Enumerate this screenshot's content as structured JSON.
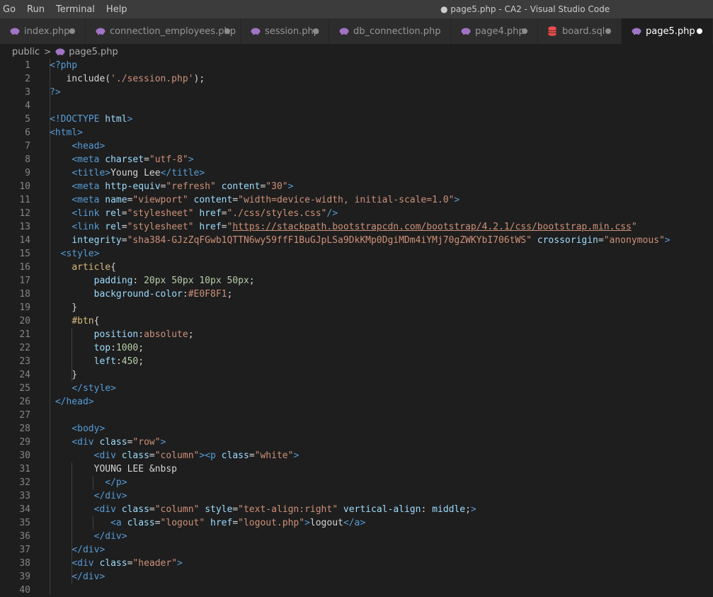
{
  "menu": [
    "Go",
    "Run",
    "Terminal",
    "Help"
  ],
  "window_title": "● page5.php - CA2 - Visual Studio Code",
  "tabs": [
    {
      "label": "index.php",
      "icon": "php-elephant-icon",
      "icon_color": "#a074c4",
      "modified": true,
      "active": false
    },
    {
      "label": "connection_employees.php",
      "icon": "php-elephant-icon",
      "icon_color": "#a074c4",
      "modified": true,
      "active": false
    },
    {
      "label": "session.php",
      "icon": "php-elephant-icon",
      "icon_color": "#a074c4",
      "modified": true,
      "active": false
    },
    {
      "label": "db_connection.php",
      "icon": "php-elephant-icon",
      "icon_color": "#a074c4",
      "modified": false,
      "active": false
    },
    {
      "label": "page4.php",
      "icon": "php-elephant-icon",
      "icon_color": "#a074c4",
      "modified": true,
      "active": false
    },
    {
      "label": "board.sql",
      "icon": "database-icon",
      "icon_color": "#f14c4c",
      "modified": true,
      "active": false
    },
    {
      "label": "page5.php",
      "icon": "php-elephant-icon",
      "icon_color": "#a074c4",
      "modified": true,
      "active": true
    }
  ],
  "breadcrumb": {
    "folder": "public",
    "file": "page5.php"
  },
  "code_lines": [
    [
      [
        "php",
        "<?php"
      ]
    ],
    [
      [
        "text",
        "   include("
      ],
      [
        "str",
        "'./session.php'"
      ],
      [
        "text",
        ");"
      ]
    ],
    [
      [
        "php",
        "?>"
      ]
    ],
    [],
    [
      [
        "tag",
        "<!DOCTYPE "
      ],
      [
        "attr",
        "html"
      ],
      [
        "tag",
        ">"
      ]
    ],
    [
      [
        "tag",
        "<html>"
      ]
    ],
    [
      [
        "text",
        "    "
      ],
      [
        "tag",
        "<head>"
      ]
    ],
    [
      [
        "text",
        "    "
      ],
      [
        "tag",
        "<meta "
      ],
      [
        "attr",
        "charset"
      ],
      [
        "text",
        "="
      ],
      [
        "str",
        "\"utf-8\""
      ],
      [
        "tag",
        ">"
      ]
    ],
    [
      [
        "text",
        "    "
      ],
      [
        "tag",
        "<title>"
      ],
      [
        "text",
        "Young Lee"
      ],
      [
        "tag",
        "</title>"
      ]
    ],
    [
      [
        "text",
        "    "
      ],
      [
        "tag",
        "<meta "
      ],
      [
        "attr",
        "http-equiv"
      ],
      [
        "text",
        "="
      ],
      [
        "str",
        "\"refresh\""
      ],
      [
        "text",
        " "
      ],
      [
        "attr",
        "content"
      ],
      [
        "text",
        "="
      ],
      [
        "str",
        "\"30\""
      ],
      [
        "tag",
        ">"
      ]
    ],
    [
      [
        "text",
        "    "
      ],
      [
        "tag",
        "<meta "
      ],
      [
        "attr",
        "name"
      ],
      [
        "text",
        "="
      ],
      [
        "str",
        "\"viewport\""
      ],
      [
        "text",
        " "
      ],
      [
        "attr",
        "content"
      ],
      [
        "text",
        "="
      ],
      [
        "str",
        "\"width=device-width, initial-scale=1.0\""
      ],
      [
        "tag",
        ">"
      ]
    ],
    [
      [
        "text",
        "    "
      ],
      [
        "tag",
        "<link "
      ],
      [
        "attr",
        "rel"
      ],
      [
        "text",
        "="
      ],
      [
        "str",
        "\"stylesheet\""
      ],
      [
        "text",
        " "
      ],
      [
        "attr",
        "href"
      ],
      [
        "text",
        "="
      ],
      [
        "str",
        "\"./css/styles.css\""
      ],
      [
        "tag",
        "/>"
      ]
    ],
    [
      [
        "text",
        "    "
      ],
      [
        "tag",
        "<link "
      ],
      [
        "attr",
        "rel"
      ],
      [
        "text",
        "="
      ],
      [
        "str",
        "\"stylesheet\""
      ],
      [
        "text",
        " "
      ],
      [
        "attr",
        "href"
      ],
      [
        "text",
        "="
      ],
      [
        "str",
        "\""
      ],
      [
        "url",
        "https://stackpath.bootstrapcdn.com/bootstrap/4.2.1/css/bootstrap.min.css"
      ],
      [
        "str",
        "\""
      ]
    ],
    [
      [
        "text",
        "    "
      ],
      [
        "attr",
        "integrity"
      ],
      [
        "text",
        "="
      ],
      [
        "str",
        "\"sha384-GJzZqFGwb1QTTN6wy59ffF1BuGJpLSa9DkKMp0DgiMDm4iYMj70gZWKYbI706tWS\""
      ],
      [
        "text",
        " "
      ],
      [
        "attr",
        "crossorigin"
      ],
      [
        "text",
        "="
      ],
      [
        "str",
        "\"anonymous\""
      ],
      [
        "tag",
        ">"
      ]
    ],
    [
      [
        "text",
        "  "
      ],
      [
        "tag",
        "<style>"
      ]
    ],
    [
      [
        "text",
        "    "
      ],
      [
        "sel",
        "article"
      ],
      [
        "text",
        "{"
      ]
    ],
    [
      [
        "text",
        "        "
      ],
      [
        "prop",
        "padding"
      ],
      [
        "text",
        ": "
      ],
      [
        "num",
        "20px 50px 10px 50px"
      ],
      [
        "text",
        ";"
      ]
    ],
    [
      [
        "text",
        "        "
      ],
      [
        "prop",
        "background-color"
      ],
      [
        "text",
        ":"
      ],
      [
        "str",
        "#E0F8F1"
      ],
      [
        "text",
        ";"
      ]
    ],
    [
      [
        "text",
        "    }"
      ]
    ],
    [
      [
        "text",
        "    "
      ],
      [
        "sel",
        "#btn"
      ],
      [
        "text",
        "{"
      ]
    ],
    [
      [
        "text",
        "        "
      ],
      [
        "prop",
        "position"
      ],
      [
        "text",
        ":"
      ],
      [
        "str",
        "absolute"
      ],
      [
        "text",
        ";"
      ]
    ],
    [
      [
        "text",
        "        "
      ],
      [
        "prop",
        "top"
      ],
      [
        "text",
        ":"
      ],
      [
        "num",
        "1000"
      ],
      [
        "text",
        ";"
      ]
    ],
    [
      [
        "text",
        "        "
      ],
      [
        "prop",
        "left"
      ],
      [
        "text",
        ":"
      ],
      [
        "num",
        "450"
      ],
      [
        "text",
        ";"
      ]
    ],
    [
      [
        "text",
        "    }"
      ]
    ],
    [
      [
        "text",
        "    "
      ],
      [
        "tag",
        "</style>"
      ]
    ],
    [
      [
        "text",
        " "
      ],
      [
        "tag",
        "</head>"
      ]
    ],
    [],
    [
      [
        "text",
        "    "
      ],
      [
        "tag",
        "<body>"
      ]
    ],
    [
      [
        "text",
        "    "
      ],
      [
        "tag",
        "<div "
      ],
      [
        "attr",
        "class"
      ],
      [
        "text",
        "="
      ],
      [
        "str",
        "\"row\""
      ],
      [
        "tag",
        ">"
      ]
    ],
    [
      [
        "text",
        "        "
      ],
      [
        "tag",
        "<div "
      ],
      [
        "attr",
        "class"
      ],
      [
        "text",
        "="
      ],
      [
        "str",
        "\"column\""
      ],
      [
        "tag",
        "><p "
      ],
      [
        "attr",
        "class"
      ],
      [
        "text",
        "="
      ],
      [
        "str",
        "\"white\""
      ],
      [
        "tag",
        ">"
      ]
    ],
    [
      [
        "text",
        "        YOUNG LEE &nbsp"
      ]
    ],
    [
      [
        "text",
        "          "
      ],
      [
        "tag",
        "</p>"
      ]
    ],
    [
      [
        "text",
        "        "
      ],
      [
        "tag",
        "</div>"
      ]
    ],
    [
      [
        "text",
        "        "
      ],
      [
        "tag",
        "<div "
      ],
      [
        "attr",
        "class"
      ],
      [
        "text",
        "="
      ],
      [
        "str",
        "\"column\""
      ],
      [
        "text",
        " "
      ],
      [
        "attr",
        "style"
      ],
      [
        "text",
        "="
      ],
      [
        "str",
        "\"text-align:right\""
      ],
      [
        "text",
        " "
      ],
      [
        "attr",
        "vertical-align"
      ],
      [
        "text",
        ": "
      ],
      [
        "attr",
        "middle"
      ],
      [
        "text",
        ";"
      ],
      [
        "tag",
        ">"
      ]
    ],
    [
      [
        "text",
        "           "
      ],
      [
        "tag",
        "<a "
      ],
      [
        "attr",
        "class"
      ],
      [
        "text",
        "="
      ],
      [
        "str",
        "\"logout\""
      ],
      [
        "text",
        " "
      ],
      [
        "attr",
        "href"
      ],
      [
        "text",
        "="
      ],
      [
        "str",
        "\"logout.php\""
      ],
      [
        "tag",
        ">"
      ],
      [
        "text",
        "logout"
      ],
      [
        "tag",
        "</a>"
      ]
    ],
    [
      [
        "text",
        "        "
      ],
      [
        "tag",
        "</div>"
      ]
    ],
    [
      [
        "text",
        "    "
      ],
      [
        "tag",
        "</div>"
      ]
    ],
    [
      [
        "text",
        "    "
      ],
      [
        "tag",
        "<div "
      ],
      [
        "attr",
        "class"
      ],
      [
        "text",
        "="
      ],
      [
        "str",
        "\"header\""
      ],
      [
        "tag",
        ">"
      ]
    ],
    [
      [
        "text",
        "    "
      ],
      [
        "tag",
        "</div>"
      ]
    ],
    []
  ]
}
